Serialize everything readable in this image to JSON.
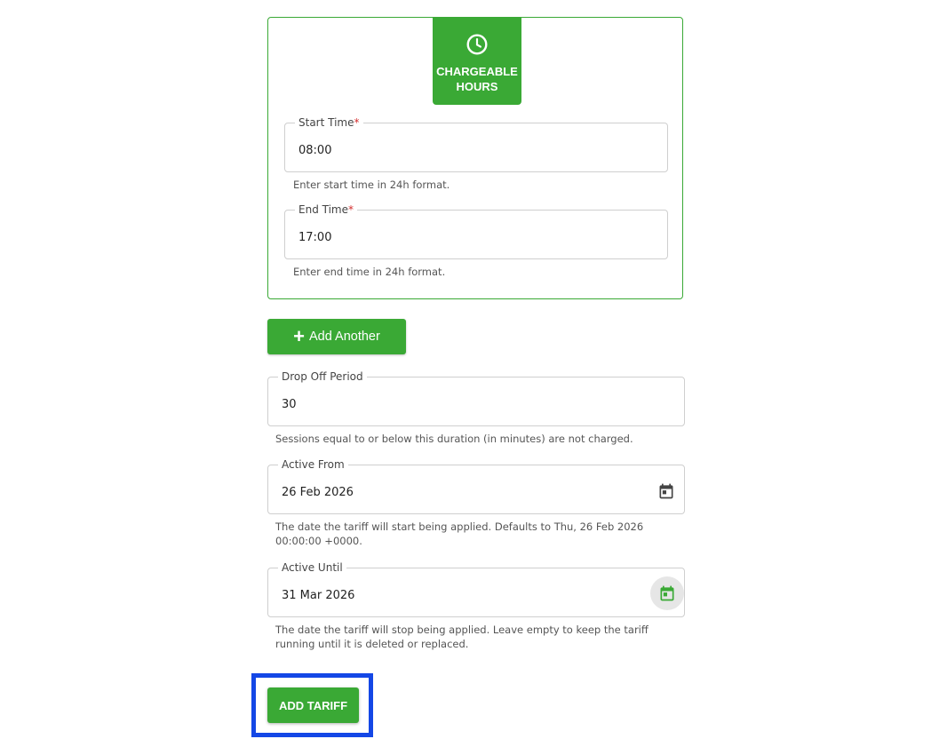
{
  "chargeable_hours": {
    "header_title": "CHARGEABLE\nHOURS",
    "header_icon": "clock-icon",
    "start_time": {
      "label": "Start Time",
      "required_mark": "*",
      "value": "08:00",
      "helper": "Enter start time in 24h format."
    },
    "end_time": {
      "label": "End Time",
      "required_mark": "*",
      "value": "17:00",
      "helper": "Enter end time in 24h format."
    }
  },
  "add_another": {
    "icon": "plus-icon",
    "label": "Add Another"
  },
  "drop_off_period": {
    "label": "Drop Off Period",
    "value": "30",
    "helper": "Sessions equal to or below this duration (in minutes) are not charged."
  },
  "active_from": {
    "label": "Active From",
    "value": "26 Feb 2026",
    "icon": "calendar-icon",
    "helper_line1": "The date the tariff will start being applied. Defaults to Thu, 26 Feb 2026",
    "helper_line2": "00:00:00 +0000."
  },
  "active_until": {
    "label": "Active Until",
    "value": "31 Mar 2026",
    "icon": "calendar-icon",
    "helper_line1": "The date the tariff will stop being applied. Leave empty to keep the tariff",
    "helper_line2": "running until it is deleted or replaced."
  },
  "add_tariff": {
    "label": "ADD TARIFF"
  },
  "colors": {
    "accent": "#3aa935",
    "required": "#d32f2f",
    "highlight": "#1447e6",
    "icon_dark": "#444444"
  }
}
